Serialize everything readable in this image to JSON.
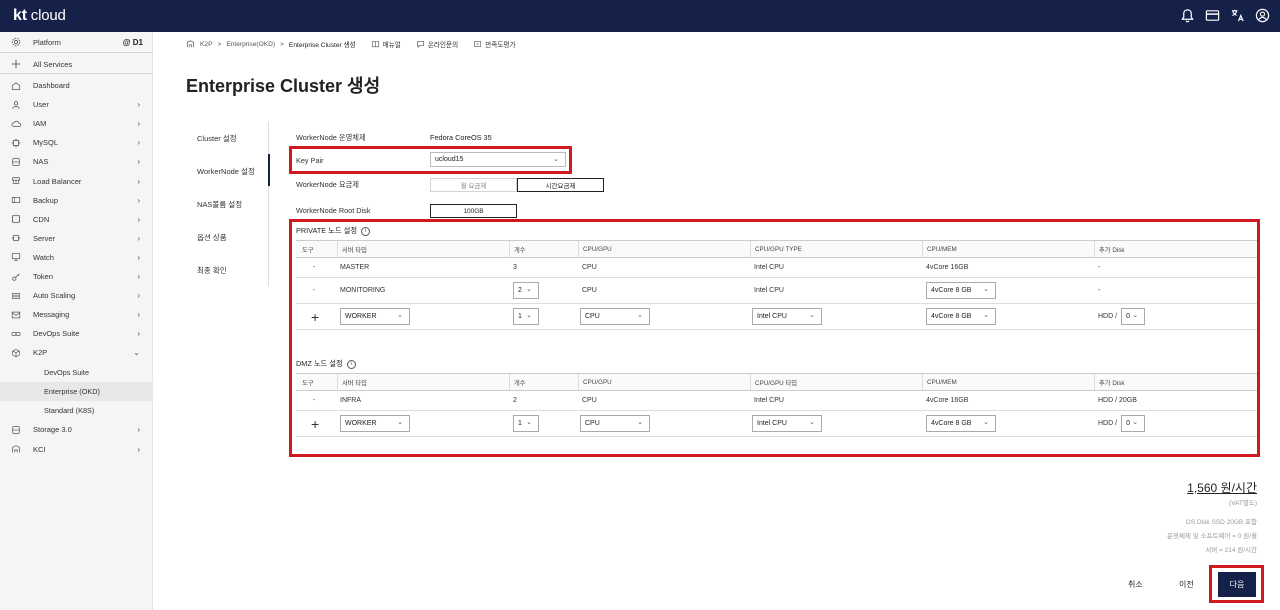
{
  "app": {
    "logo_bold": "kt",
    "logo_rest": " cloud"
  },
  "topbar": {
    "icons": [
      "bell-icon",
      "card-icon",
      "language-icon",
      "user-icon"
    ]
  },
  "sidebar": {
    "platform": "Platform",
    "zone": "@ D1",
    "all_services": "All Services",
    "items": [
      {
        "label": "Dashboard",
        "icon": "home-icon"
      },
      {
        "label": "User",
        "icon": "user-icon"
      },
      {
        "label": "IAM",
        "icon": "cloud-lock-icon"
      },
      {
        "label": "MySQL",
        "icon": "chip-icon"
      },
      {
        "label": "NAS",
        "icon": "storage-icon"
      },
      {
        "label": "Load Balancer",
        "icon": "load-balancer-icon"
      },
      {
        "label": "Backup",
        "icon": "backup-icon"
      },
      {
        "label": "CDN",
        "icon": "cdn-icon"
      },
      {
        "label": "Server",
        "icon": "server-icon"
      },
      {
        "label": "Watch",
        "icon": "monitor-icon"
      },
      {
        "label": "Token",
        "icon": "key-icon"
      },
      {
        "label": "Auto Scaling",
        "icon": "scaling-icon"
      },
      {
        "label": "Messaging",
        "icon": "mail-icon"
      },
      {
        "label": "DevOps Suite",
        "icon": "link-icon"
      },
      {
        "label": "K2P",
        "icon": "cube-icon"
      }
    ],
    "sub_items": [
      "DevOps Suite",
      "Enterprise (OKD)",
      "Standard (K8S)"
    ],
    "bottom_items": [
      {
        "label": "Storage 3.0",
        "icon": "storage-icon"
      },
      {
        "label": "KCI",
        "icon": "kci-icon"
      }
    ]
  },
  "breadcrumb": {
    "root": "K2P",
    "sep": ">",
    "mid": "Enterprise(OKD)",
    "current": "Enterprise Cluster 생성",
    "links": [
      "매뉴얼",
      "온라인문의",
      "만족도평가"
    ]
  },
  "page": {
    "title": "Enterprise Cluster 생성"
  },
  "steps": [
    "Cluster 설정",
    "WorkerNode 설정",
    "NAS볼륨 설정",
    "옵션 상품",
    "최종 확인"
  ],
  "form": {
    "os_label": "WorkerNode 운영체제",
    "os_value": "Fedora CoreOS 35",
    "keypair_label": "Key Pair",
    "keypair_value": "ucloud15",
    "billing_label": "WorkerNode 요금제",
    "billing_options": [
      "월 요금제",
      "시간요금제"
    ],
    "disk_label": "WorkerNode Root Disk",
    "disk_value": "100GB"
  },
  "private": {
    "title": "PRIVATE 노드 설정",
    "headers": [
      "도구",
      "서버 타입",
      "개수",
      "CPU/GPU",
      "CPU/GPU TYPE",
      "CPU/MEM",
      "추가 Disk"
    ],
    "rows": [
      [
        "-",
        "MASTER",
        "3",
        "CPU",
        "Intel CPU",
        "4vCore 16GB",
        "-"
      ],
      [
        "-",
        "MONITORING",
        "2",
        "CPU",
        "Intel CPU",
        "4vCore 8 GB",
        "-"
      ]
    ],
    "new_row": {
      "type": "WORKER",
      "count": "1",
      "cpu": "CPU",
      "cpu_type": "Intel CPU",
      "mem": "4vCore 8 GB",
      "disk_prefix": "HDD /",
      "disk": "0"
    }
  },
  "dmz": {
    "title": "DMZ 노드 설정",
    "headers": [
      "도구",
      "서버 타입",
      "개수",
      "CPU/GPU",
      "CPU/GPU 타입",
      "CPU/MEM",
      "추가 Disk"
    ],
    "rows": [
      [
        "-",
        "INFRA",
        "2",
        "CPU",
        "Intel CPU",
        "4vCore 16GB",
        "HDD / 20GB"
      ]
    ],
    "new_row": {
      "type": "WORKER",
      "count": "1",
      "cpu": "CPU",
      "cpu_type": "Intel CPU",
      "mem": "4vCore 8 GB",
      "disk_prefix": "HDD /",
      "disk": "0"
    }
  },
  "price": {
    "total": "1,560 원/시간",
    "vat": "(VAT별도)",
    "notes": [
      "OS Disk SSD 20GB 포함",
      "운영체제 및 소프트웨어 = 0 원/월",
      "서버 = 214 원/시간"
    ]
  },
  "actions": {
    "cancel": "취소",
    "prev": "이전",
    "next": "다음"
  },
  "colors": {
    "navy": "#16214a",
    "highlight": "#d0191f"
  }
}
